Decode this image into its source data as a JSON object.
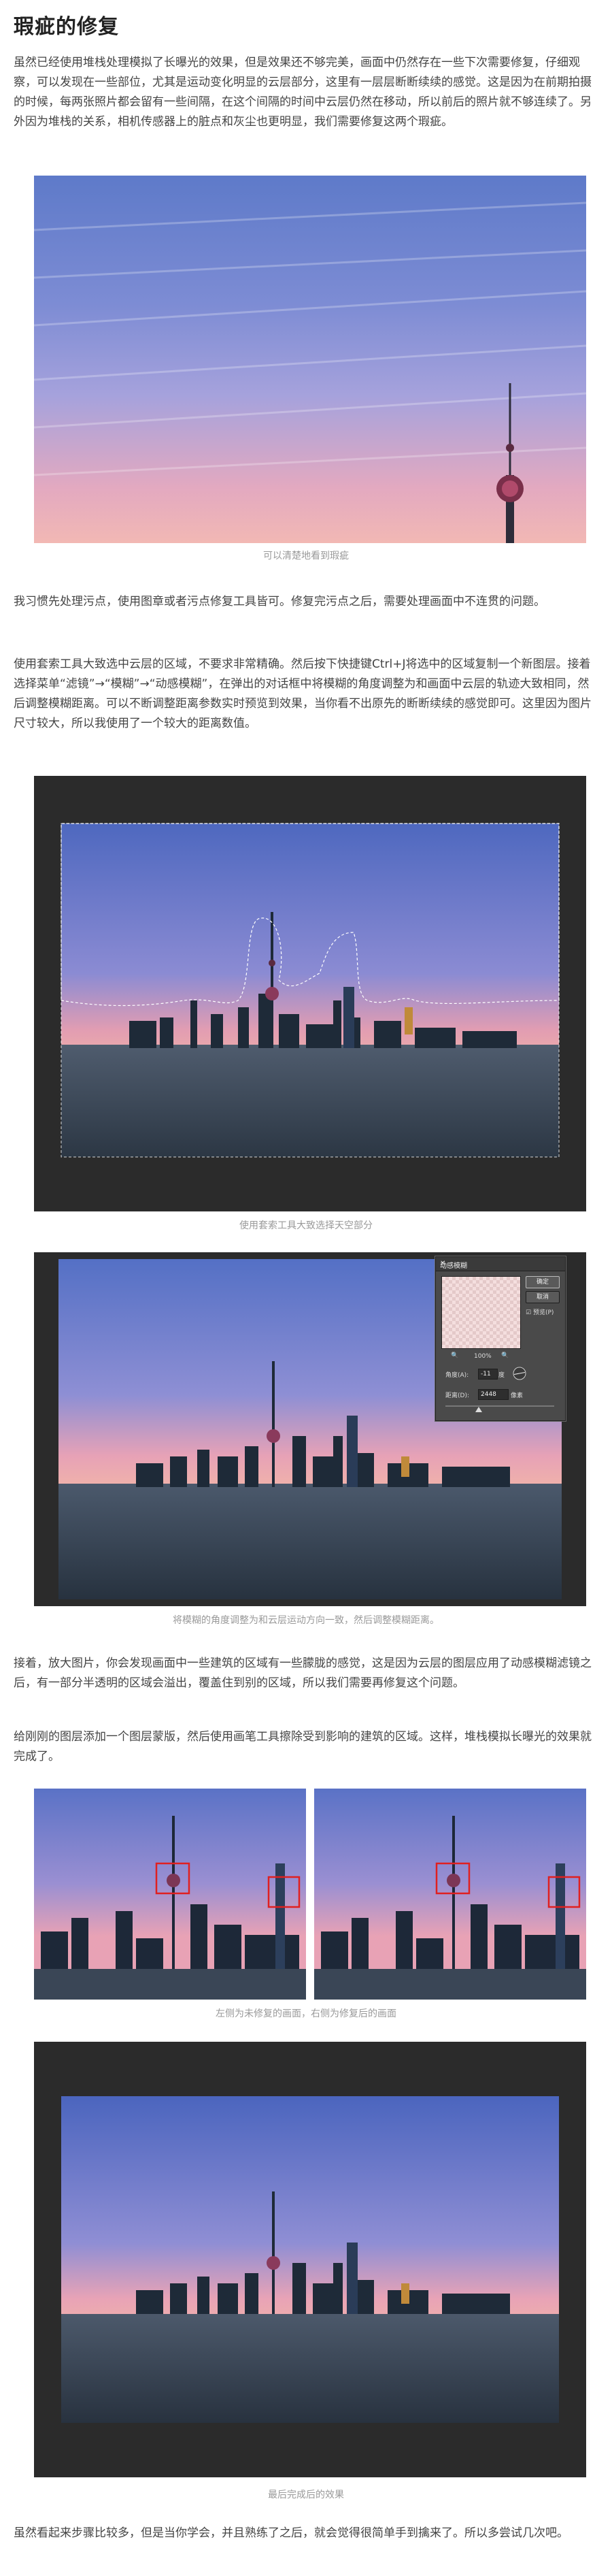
{
  "title": "瑕疵的修复",
  "paragraphs": {
    "p1": "虽然已经使用堆栈处理模拟了长曝光的效果，但是效果还不够完美，画面中仍然存在一些下次需要修复，仔细观察，可以发现在一些部位，尤其是运动变化明显的云层部分，这里有一层层断断续续的感觉。这是因为在前期拍摄的时候，每两张照片都会留有一些间隔，在这个间隔的时间中云层仍然在移动，所以前后的照片就不够连续了。另外因为堆栈的关系，相机传感器上的脏点和灰尘也更明显，我们需要修复这两个瑕疵。",
    "p2": "我习惯先处理污点，使用图章或者污点修复工具皆可。修复完污点之后，需要处理画面中不连贯的问题。",
    "p3": "使用套索工具大致选中云层的区域，不要求非常精确。然后按下快捷键Ctrl+J将选中的区域复制一个新图层。接着选择菜单“滤镜”→“模糊”→“动感模糊”，在弹出的对话框中将模糊的角度调整为和画面中云层的轨迹大致相同，然后调整模糊距离。可以不断调整距离参数实时预览到效果，当你看不出原先的断断续续的感觉即可。这里因为图片尺寸较大，所以我使用了一个较大的距离数值。",
    "p4": "接着，放大图片，你会发现画面中一些建筑的区域有一些朦胧的感觉，这是因为云层的图层应用了动感模糊滤镜之后，有一部分半透明的区域会溢出，覆盖住到别的区域，所以我们需要再修复这个问题。",
    "p5": "给刚刚的图层添加一个图层蒙版，然后使用画笔工具擦除受到影响的建筑的区域。这样，堆栈模拟长曝光的效果就完成了。",
    "p6": "虽然看起来步骤比较多，但是当你学会，并且熟练了之后，就会觉得很简单手到擒来了。所以多尝试几次吧。"
  },
  "captions": {
    "c1": "可以清楚地看到瑕疵",
    "c2": "使用套索工具大致选择天空部分",
    "c3": "将模糊的角度调整为和云层运动方向一致，然后调整模糊距离。",
    "c4": "左侧为未修复的画面，右侧为修复后的画面",
    "c5": "最后完成后的效果"
  },
  "dialog": {
    "title": "动感模糊",
    "ok": "确定",
    "cancel": "取消",
    "preview": "预览(P)",
    "zoom": "100%",
    "angle_label": "角度(A):",
    "angle_value": "-11",
    "angle_unit": "度",
    "distance_label": "距离(D):",
    "distance_value": "2448",
    "distance_unit": "像素"
  },
  "colors": {
    "sky_top": "#5f78c8",
    "sky_mid": "#8a8fd6",
    "sky_pink": "#e7a3b5",
    "water": "#3c4a58",
    "frame_dark": "#2b2b2b",
    "caption_gray": "#999999",
    "highlight_red": "#e02020"
  }
}
